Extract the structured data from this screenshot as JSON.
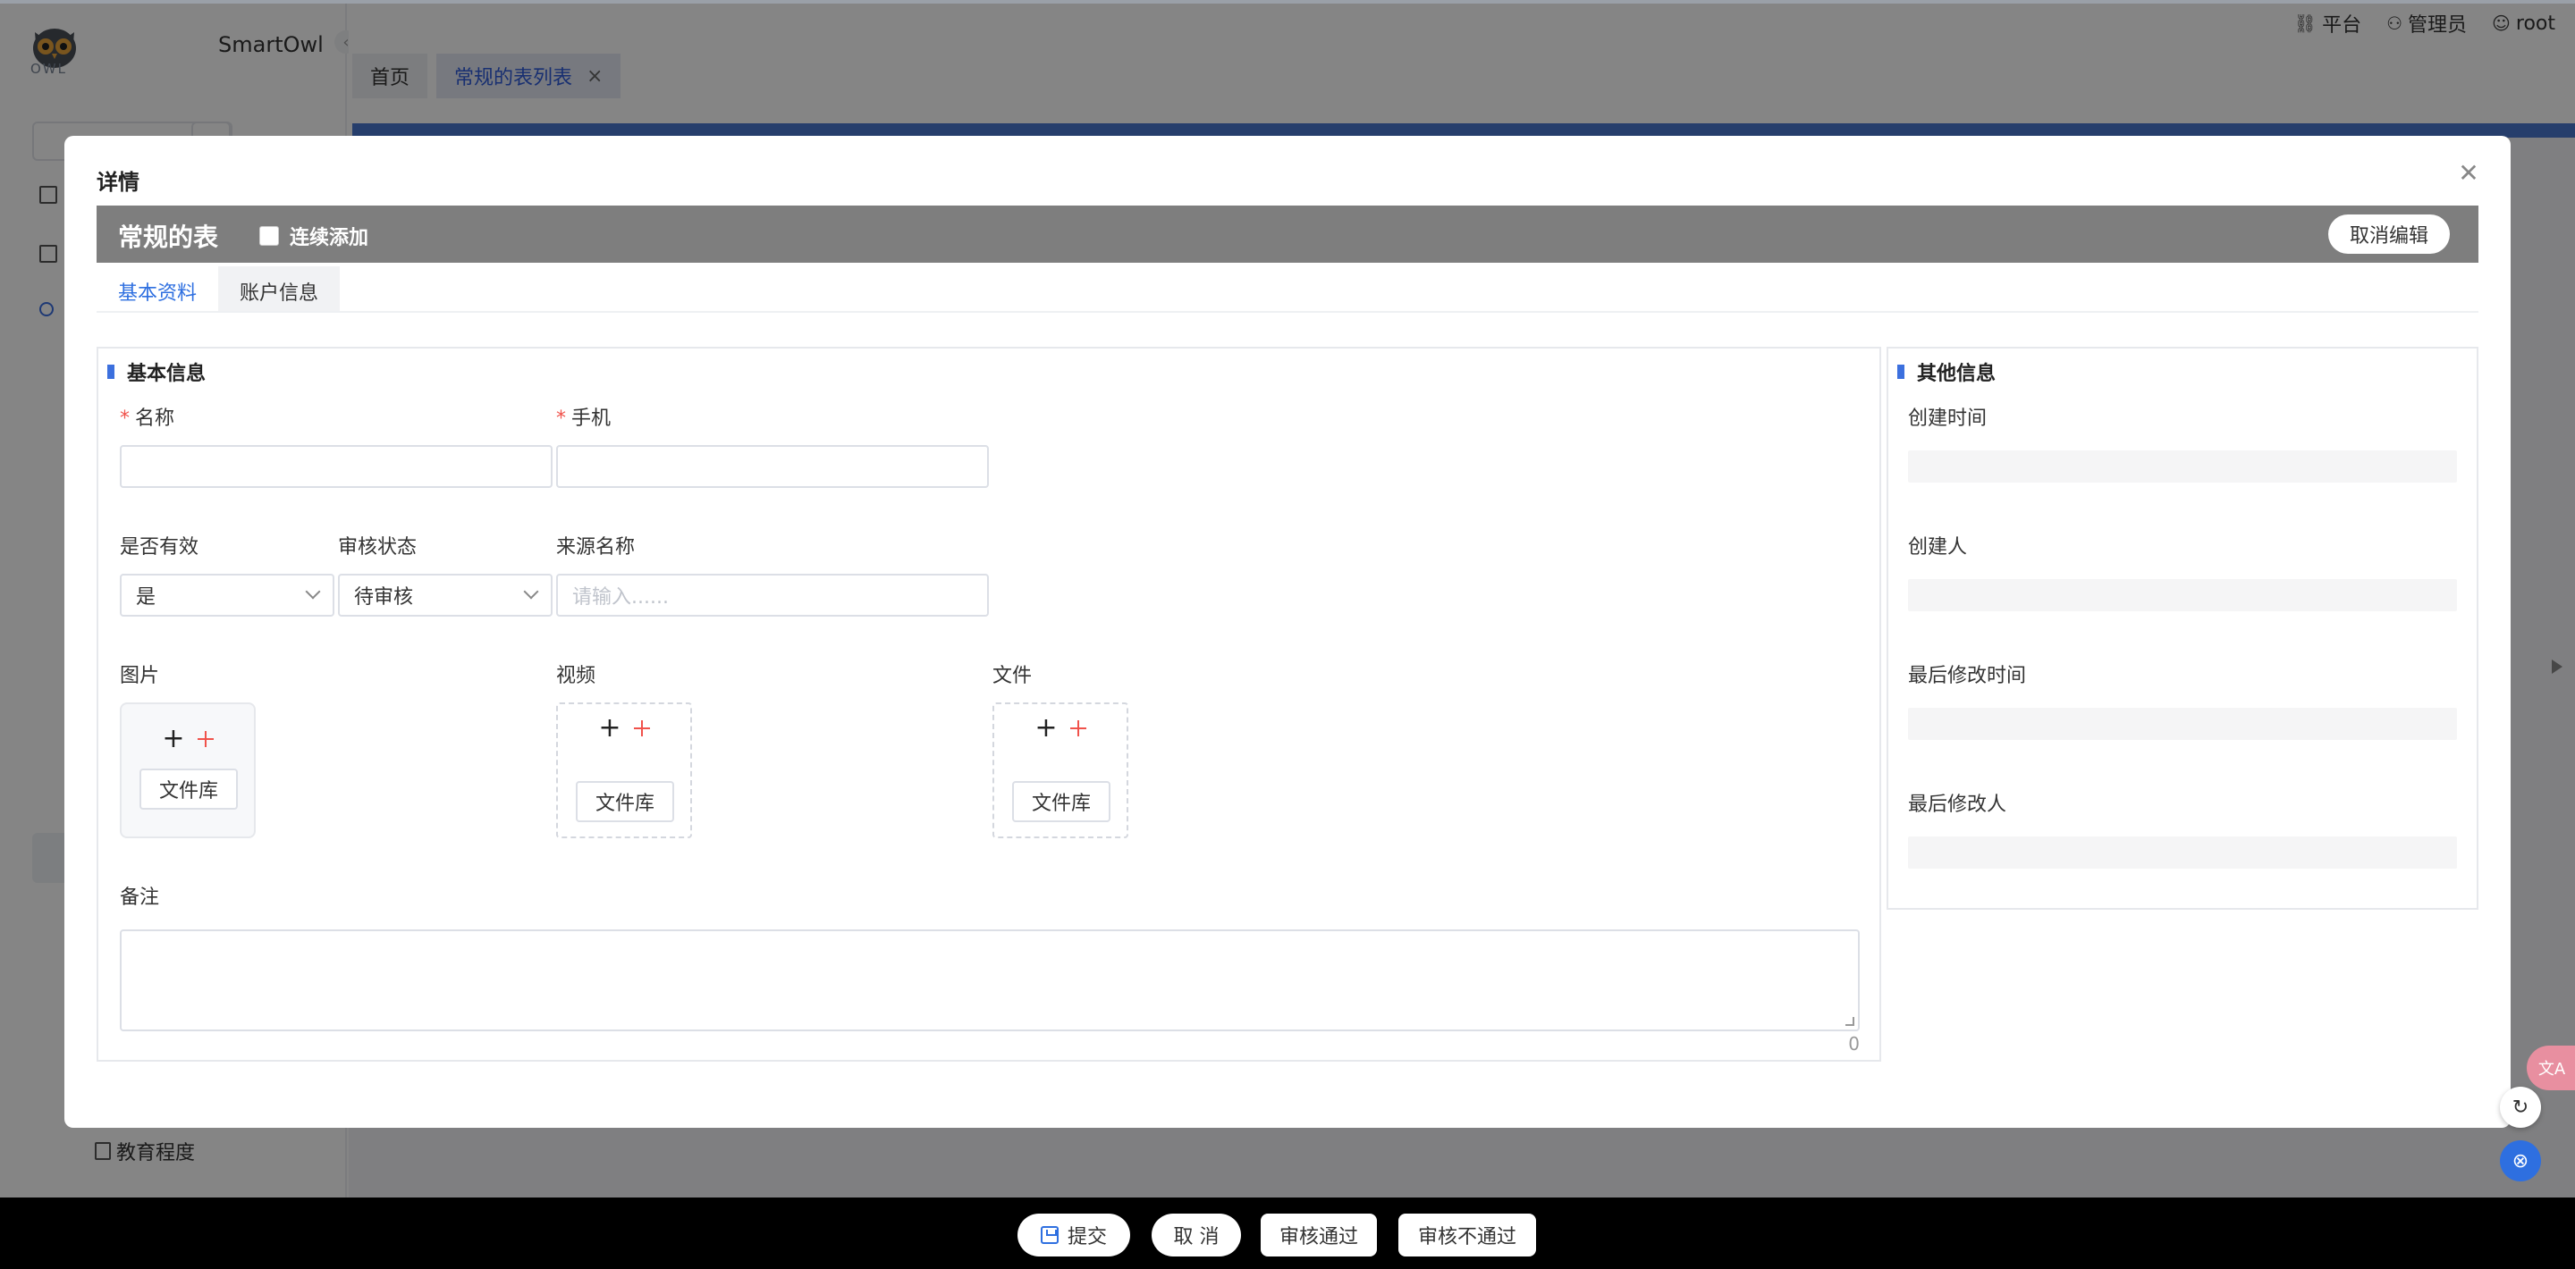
{
  "app": {
    "name": "SmartOwl",
    "logo_text": "OWL"
  },
  "topbar": {
    "links": [
      {
        "icon": "platform-icon",
        "label": "平台"
      },
      {
        "icon": "admin-icon",
        "label": "管理员"
      },
      {
        "icon": "user-icon",
        "label": "root"
      }
    ]
  },
  "page_tabs": [
    {
      "label": "首页",
      "active": false
    },
    {
      "label": "常规的表列表",
      "active": true
    }
  ],
  "sidebar": {
    "leaf_item": "教育程度"
  },
  "modal": {
    "title": "详情",
    "form_title": "常规的表",
    "continuous_add": "连续添加",
    "cancel_edit": "取消编辑",
    "tabs": [
      "基本资料",
      "账户信息"
    ],
    "basic": {
      "section_title": "基本信息",
      "name_label": "名称",
      "phone_label": "手机",
      "valid_label": "是否有效",
      "valid_value": "是",
      "audit_label": "审核状态",
      "audit_value": "待审核",
      "source_label": "来源名称",
      "source_placeholder": "请输入......",
      "image_label": "图片",
      "video_label": "视频",
      "file_label": "文件",
      "library_button": "文件库",
      "remark_label": "备注",
      "remark_count": "0"
    },
    "other": {
      "section_title": "其他信息",
      "created_time": "创建时间",
      "creator": "创建人",
      "modified_time": "最后修改时间",
      "modifier": "最后修改人"
    }
  },
  "footer": {
    "submit": "提交",
    "cancel": "取 消",
    "approve": "审核通过",
    "reject": "审核不通过"
  },
  "colors": {
    "accent": "#2e6fe0",
    "required": "#f0524b",
    "header_gray": "#7e7e7e"
  }
}
